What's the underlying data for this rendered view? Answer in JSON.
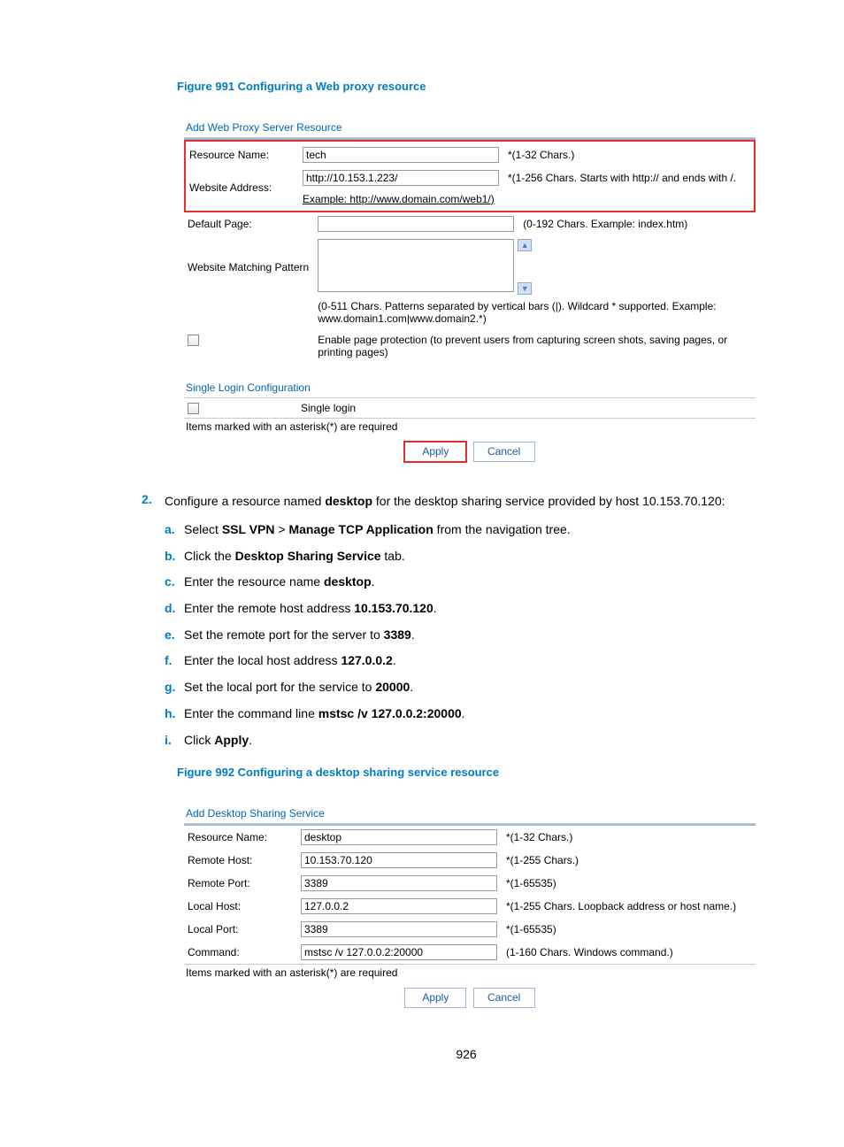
{
  "figure1": {
    "title": "Figure 991 Configuring a Web proxy resource",
    "panel_head": "Add Web Proxy Server Resource",
    "rows": {
      "resource_name": {
        "label": "Resource Name:",
        "value": "tech",
        "hint": "*(1-32 Chars.)"
      },
      "website_address": {
        "label": "Website Address:",
        "value": "http://10.153.1.223/",
        "hint": "*(1-256 Chars. Starts with http:// and ends with /.",
        "example": "Example: http://www.domain.com/web1/)"
      },
      "default_page": {
        "label": "Default Page:",
        "value": "",
        "hint": "(0-192 Chars. Example: index.htm)"
      },
      "pattern": {
        "label": "Website Matching Pattern",
        "value": "",
        "hint": "(0-511 Chars. Patterns separated by vertical bars (|). Wildcard * supported. Example: www.domain1.com|www.domain2.*)"
      },
      "protection": "Enable page protection (to prevent users from capturing screen shots, saving pages, or printing pages)"
    },
    "single_login_head": "Single Login Configuration",
    "single_login_label": "Single login",
    "required_note": "Items marked with an asterisk(*) are required",
    "apply": "Apply",
    "cancel": "Cancel"
  },
  "instructions": {
    "step_num": "2.",
    "step_intro_pre": "Configure a resource named ",
    "step_intro_bold": "desktop",
    "step_intro_post": " for the desktop sharing service provided by host 10.153.70.120:",
    "sub": [
      {
        "n": "a.",
        "pre": "Select ",
        "b1": "SSL VPN",
        "mid": " > ",
        "b2": "Manage TCP Application",
        "post": " from the navigation tree."
      },
      {
        "n": "b.",
        "pre": "Click the ",
        "b1": "Desktop Sharing Service",
        "post": " tab."
      },
      {
        "n": "c.",
        "pre": "Enter the resource name ",
        "b1": "desktop",
        "post": "."
      },
      {
        "n": "d.",
        "pre": "Enter the remote host address ",
        "b1": "10.153.70.120",
        "post": "."
      },
      {
        "n": "e.",
        "pre": "Set the remote port for the server to ",
        "b1": "3389",
        "post": "."
      },
      {
        "n": "f.",
        "pre": "Enter the local host address ",
        "b1": "127.0.0.2",
        "post": "."
      },
      {
        "n": "g.",
        "pre": "Set the local port for the service to ",
        "b1": "20000",
        "post": "."
      },
      {
        "n": "h.",
        "pre": "Enter the command line ",
        "b1": "mstsc /v 127.0.0.2:20000",
        "post": "."
      },
      {
        "n": "i.",
        "pre": "Click ",
        "b1": "Apply",
        "post": "."
      }
    ]
  },
  "figure2": {
    "title": "Figure 992 Configuring a desktop sharing service resource",
    "panel_head": "Add Desktop Sharing Service",
    "rows": {
      "resource_name": {
        "label": "Resource Name:",
        "value": "desktop",
        "hint": "*(1-32 Chars.)"
      },
      "remote_host": {
        "label": "Remote Host:",
        "value": "10.153.70.120",
        "hint": "*(1-255 Chars.)"
      },
      "remote_port": {
        "label": "Remote Port:",
        "value": "3389",
        "hint": "*(1-65535)"
      },
      "local_host": {
        "label": "Local Host:",
        "value": "127.0.0.2",
        "hint": "*(1-255 Chars. Loopback address or host name.)"
      },
      "local_port": {
        "label": "Local Port:",
        "value": "3389",
        "hint": "*(1-65535)"
      },
      "command": {
        "label": "Command:",
        "value": "mstsc /v 127.0.0.2:20000",
        "hint": "(1-160 Chars. Windows command.)"
      }
    },
    "required_note": "Items marked with an asterisk(*) are required",
    "apply": "Apply",
    "cancel": "Cancel"
  },
  "page_number": "926"
}
